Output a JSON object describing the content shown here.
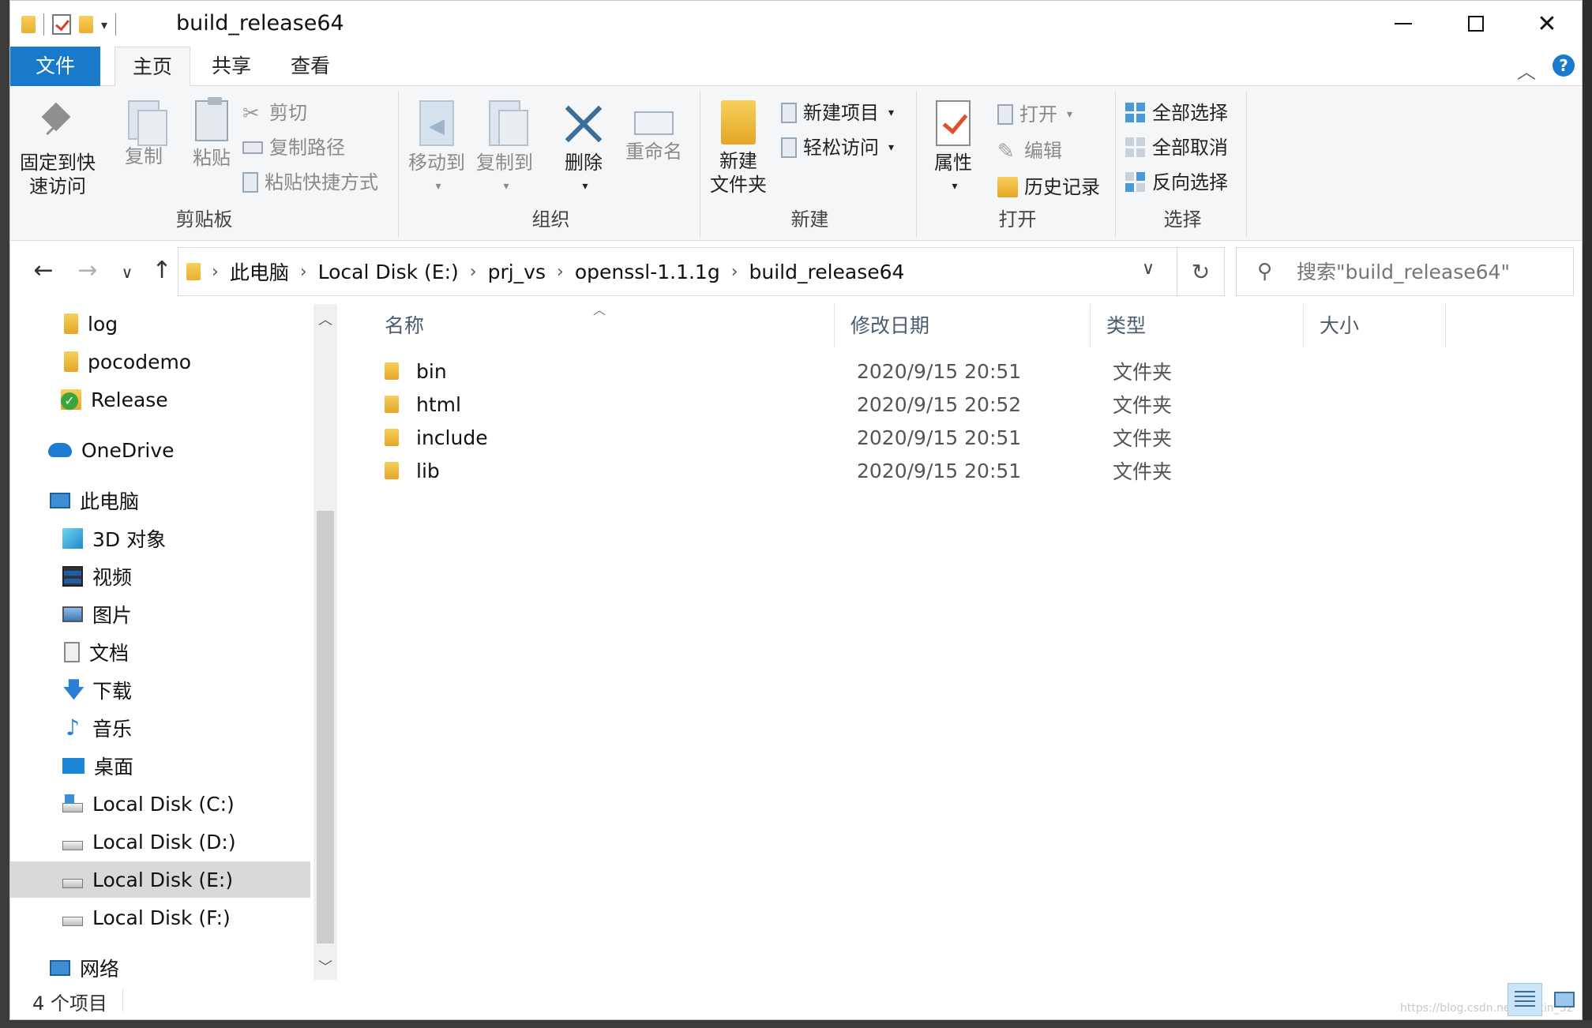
{
  "window": {
    "title": "build_release64"
  },
  "tabs": {
    "file": "文件",
    "home": "主页",
    "share": "共享",
    "view": "查看"
  },
  "ribbon": {
    "clipboard": {
      "label": "剪贴板",
      "pin_line1": "固定到快",
      "pin_line2": "速访问",
      "copy": "复制",
      "paste": "粘贴",
      "cut": "剪切",
      "copy_path": "复制路径",
      "paste_shortcut": "粘贴快捷方式"
    },
    "organize": {
      "label": "组织",
      "move_to": "移动到",
      "copy_to": "复制到",
      "delete": "删除",
      "rename": "重命名"
    },
    "new": {
      "label": "新建",
      "new_folder_line1": "新建",
      "new_folder_line2": "文件夹",
      "new_item": "新建项目",
      "easy_access": "轻松访问"
    },
    "open": {
      "label": "打开",
      "properties": "属性",
      "open": "打开",
      "edit": "编辑",
      "history": "历史记录"
    },
    "select": {
      "label": "选择",
      "select_all": "全部选择",
      "select_none": "全部取消",
      "invert": "反向选择"
    }
  },
  "address": {
    "crumbs": [
      "此电脑",
      "Local Disk (E:)",
      "prj_vs",
      "openssl-1.1.1g",
      "build_release64"
    ],
    "search_placeholder": "搜索\"build_release64\""
  },
  "nav": {
    "items": [
      {
        "label": "log",
        "icon": "folder-icon"
      },
      {
        "label": "pocodemo",
        "icon": "folder-icon"
      },
      {
        "label": "Release",
        "icon": "folder-sync-icon"
      },
      {
        "label": "OneDrive",
        "icon": "cloud-icon"
      },
      {
        "label": "此电脑",
        "icon": "computer-icon"
      },
      {
        "label": "3D 对象",
        "icon": "cube-icon"
      },
      {
        "label": "视频",
        "icon": "video-icon"
      },
      {
        "label": "图片",
        "icon": "picture-icon"
      },
      {
        "label": "文档",
        "icon": "document-icon"
      },
      {
        "label": "下载",
        "icon": "download-icon"
      },
      {
        "label": "音乐",
        "icon": "music-icon"
      },
      {
        "label": "桌面",
        "icon": "desktop-icon"
      },
      {
        "label": "Local Disk (C:)",
        "icon": "drive-icon"
      },
      {
        "label": "Local Disk (D:)",
        "icon": "drive-icon"
      },
      {
        "label": "Local Disk (E:)",
        "icon": "drive-icon"
      },
      {
        "label": "Local Disk (F:)",
        "icon": "drive-icon"
      },
      {
        "label": "网络",
        "icon": "network-icon"
      }
    ]
  },
  "columns": {
    "name": "名称",
    "date": "修改日期",
    "type": "类型",
    "size": "大小"
  },
  "files": [
    {
      "name": "bin",
      "date": "2020/9/15 20:51",
      "type": "文件夹"
    },
    {
      "name": "html",
      "date": "2020/9/15 20:52",
      "type": "文件夹"
    },
    {
      "name": "include",
      "date": "2020/9/15 20:51",
      "type": "文件夹"
    },
    {
      "name": "lib",
      "date": "2020/9/15 20:51",
      "type": "文件夹"
    }
  ],
  "status": {
    "item_count": "4 个项目"
  },
  "watermark": "https://blog.csdn.net/weixin_52",
  "colors": {
    "accent": "#1979ca",
    "selection": "#d9d9d9",
    "folder": "#e8b02f"
  }
}
